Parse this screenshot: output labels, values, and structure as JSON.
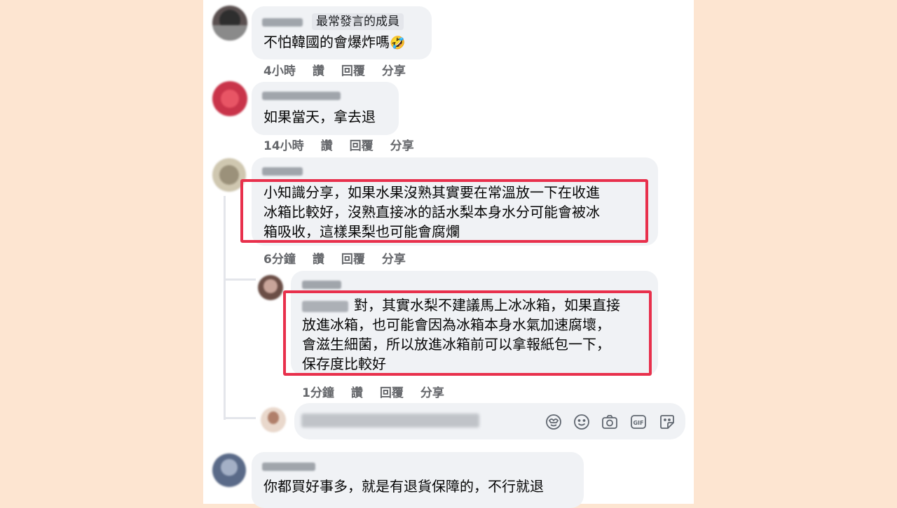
{
  "comments": [
    {
      "badge": "最常發言的成員",
      "text": "不怕韓國的會爆炸嗎",
      "emoji": "🤣",
      "time": "4小時",
      "like": "讚",
      "reply": "回覆",
      "share": "分享"
    },
    {
      "text": "如果當天，拿去退",
      "time": "14小時",
      "like": "讚",
      "reply": "回覆",
      "share": "分享"
    },
    {
      "lines": [
        "小知識分享，如果水果沒熟其實要在常溫放一下在收進",
        "冰箱比較好，沒熟直接冰的話水梨本身水分可能會被冰",
        "箱吸收，這樣果梨也可能會腐爛"
      ],
      "time": "6分鐘",
      "like": "讚",
      "reply": "回覆",
      "share": "分享",
      "highlighted": true
    },
    {
      "lines": [
        "對，其實水梨不建議馬上冰冰箱，如果直接",
        "放進冰箱，也可能會因為冰箱本身水氣加速腐壞，",
        "會滋生細菌，所以放進冰箱前可以拿報紙包一下，",
        "保存度比較好"
      ],
      "time": "1分鐘",
      "like": "讚",
      "reply": "回覆",
      "share": "分享",
      "highlighted": true,
      "is_reply": true
    },
    {
      "text": "你都買好事多，就是有退貨保障的，不行就退"
    }
  ],
  "reply_box": {
    "icons": [
      "avatar-sticker-icon",
      "emoji-icon",
      "camera-icon",
      "gif-icon",
      "sticker-icon"
    ]
  },
  "colors": {
    "background": "#fde5d1",
    "bubble": "#f0f2f5",
    "highlight": "#e8304c",
    "meta_text": "#65676b"
  }
}
